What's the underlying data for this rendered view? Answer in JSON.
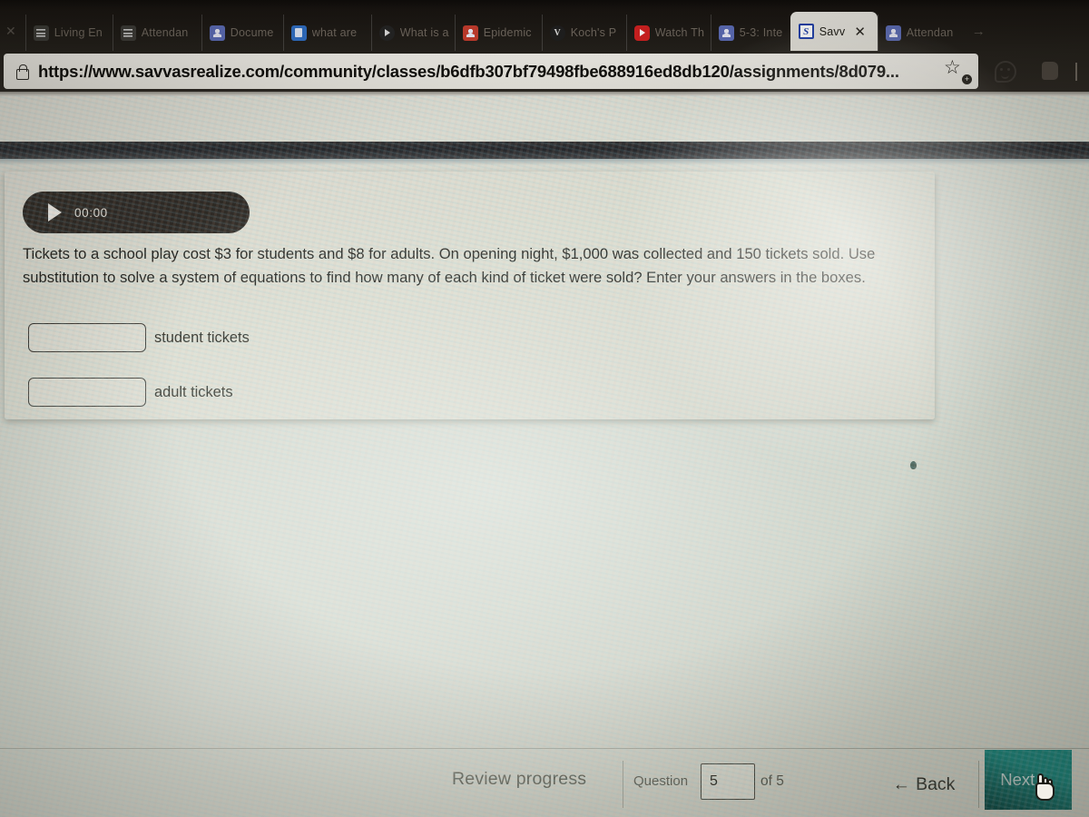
{
  "browser": {
    "tabs": [
      {
        "label": "Living En",
        "icon": "list-icon",
        "active": false
      },
      {
        "label": "Attendan",
        "icon": "list-icon",
        "active": false
      },
      {
        "label": "Docume",
        "icon": "person-icon",
        "active": false
      },
      {
        "label": "what are",
        "icon": "document-icon",
        "active": false
      },
      {
        "label": "What is a",
        "icon": "video-icon",
        "active": false
      },
      {
        "label": "Epidemic",
        "icon": "person-icon-red",
        "active": false
      },
      {
        "label": "Koch's P",
        "icon": "vhs-icon",
        "active": false
      },
      {
        "label": "Watch Th",
        "icon": "youtube-icon",
        "active": false
      },
      {
        "label": "5-3: Inte",
        "icon": "person-icon",
        "active": false
      },
      {
        "label": "Savv",
        "icon": "savvas-icon",
        "active": true
      },
      {
        "label": "Attendan",
        "icon": "person-icon",
        "active": false
      }
    ],
    "tab_close_label": "✕",
    "leading_close_label": "✕",
    "tab_overflow_label": "→",
    "savvas_favicon_letter": "S",
    "vhs_favicon_letter": "V",
    "url": "https://www.savvasrealize.com/community/classes/b6dfb307bf79498fbe688916ed8db120/assignments/8d079...",
    "toolbar_icons": [
      "favorite-star-icon",
      "feedback-smiley-icon",
      "collections-icon"
    ],
    "star_glyph": "☆",
    "star_plus_glyph": "+"
  },
  "card": {
    "audio": {
      "play_glyph": "▶",
      "time": "00:00"
    },
    "question_text": "Tickets to a school play cost $3 for students and $8 for adults. On opening night, $1,000 was collected and 150 tickets sold. Use substitution to solve a system of equations to find how many of each kind of ticket were sold? Enter your answers in the boxes.",
    "answers": [
      {
        "value": "",
        "placeholder": "",
        "label": "student tickets"
      },
      {
        "value": "",
        "placeholder": "",
        "label": "adult tickets"
      }
    ]
  },
  "bottom_nav": {
    "review_label": "Review progress",
    "question_label": "Question",
    "question_number": "5",
    "of_label": "of 5",
    "back_label": "Back",
    "back_arrow": "←",
    "next_label": "Next",
    "next_arrow": "→"
  },
  "colors": {
    "next_button": "#1c7f75",
    "audio_pill": "#2f2a25",
    "page_background": "#d5d8cd",
    "savvas_blue": "#1f3fa8"
  }
}
